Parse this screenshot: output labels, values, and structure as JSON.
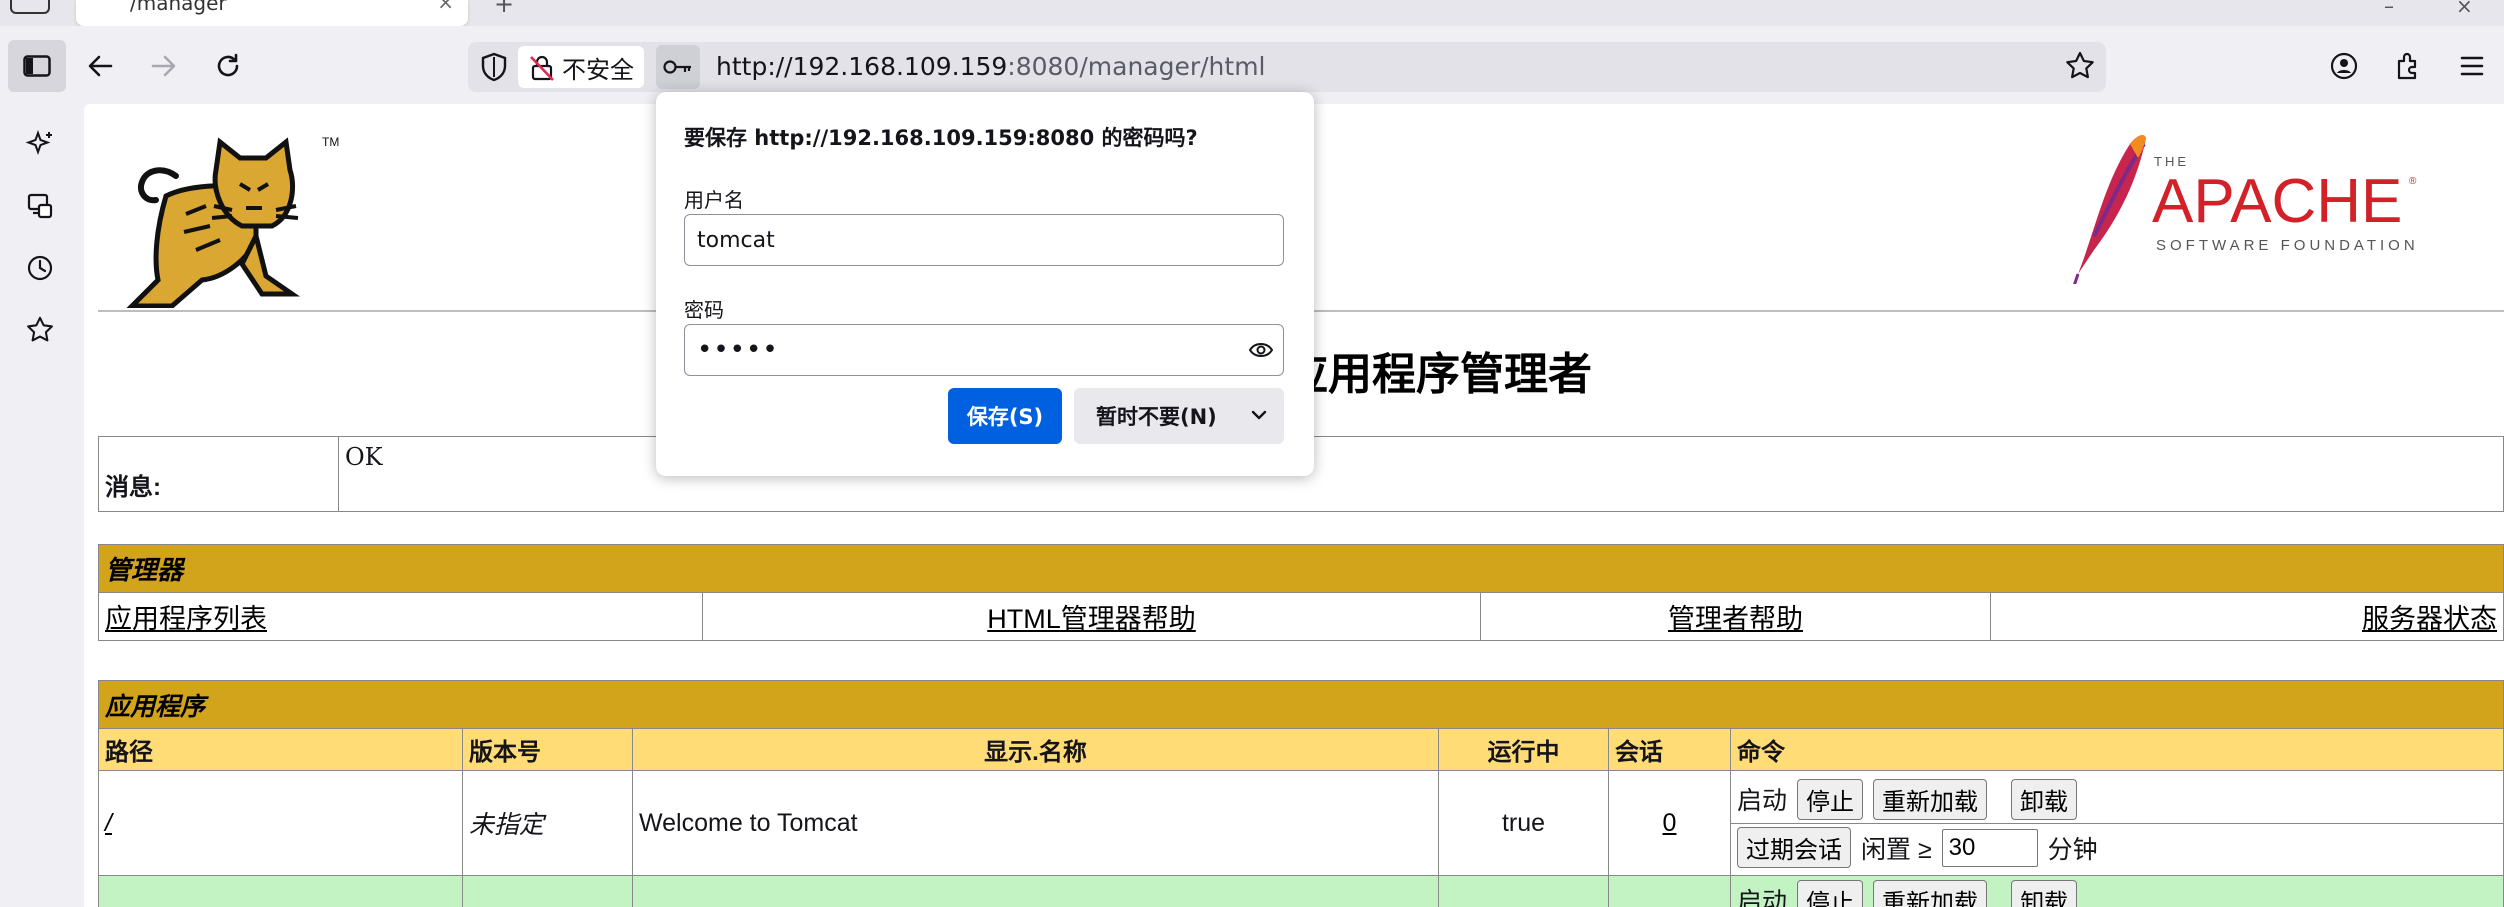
{
  "browser": {
    "tab_title": "/manager",
    "security_label": "不安全",
    "url_host_part": "http://192.168.109.159",
    "url_path_part": ":8080/manager/html"
  },
  "popup": {
    "heading": "要保存 http://192.168.109.159:8080 的密码吗?",
    "username_label": "用户名",
    "username_value": "tomcat",
    "password_label": "密码",
    "password_value": "•••••",
    "save_label": "保存(S)",
    "not_now_label": "暂时不要(N)"
  },
  "page": {
    "title": "应用程序管理者",
    "message_label": "消息:",
    "message_value": "OK",
    "manager_header": "管理器",
    "manager_links": [
      "应用程序列表",
      "HTML管理器帮助",
      "管理者帮助",
      "服务器状态"
    ],
    "apps_header": "应用程序",
    "columns": [
      "路径",
      "版本号",
      "显示.名称",
      "运行中",
      "会话",
      "命令"
    ],
    "row": {
      "path": "/",
      "version": "未指定",
      "display_name": "Welcome to Tomcat",
      "running": "true",
      "sessions": "0",
      "start_label": "启动",
      "stop_label": "停止",
      "reload_label": "重新加载",
      "undeploy_label": "卸载",
      "expire_label": "过期会话",
      "idle_label": "闲置 ≥",
      "idle_value": "30",
      "minutes_label": "分钟"
    },
    "next_row_partial": {
      "start_label": "启动",
      "stop_label": "停止",
      "reload_label": "重新加载",
      "undeploy_label": "卸载"
    }
  },
  "colors": {
    "section_header": "#d2a41c",
    "column_header": "#ffdc75",
    "next_row": "#c3f3c3",
    "save_button": "#0061e0"
  }
}
